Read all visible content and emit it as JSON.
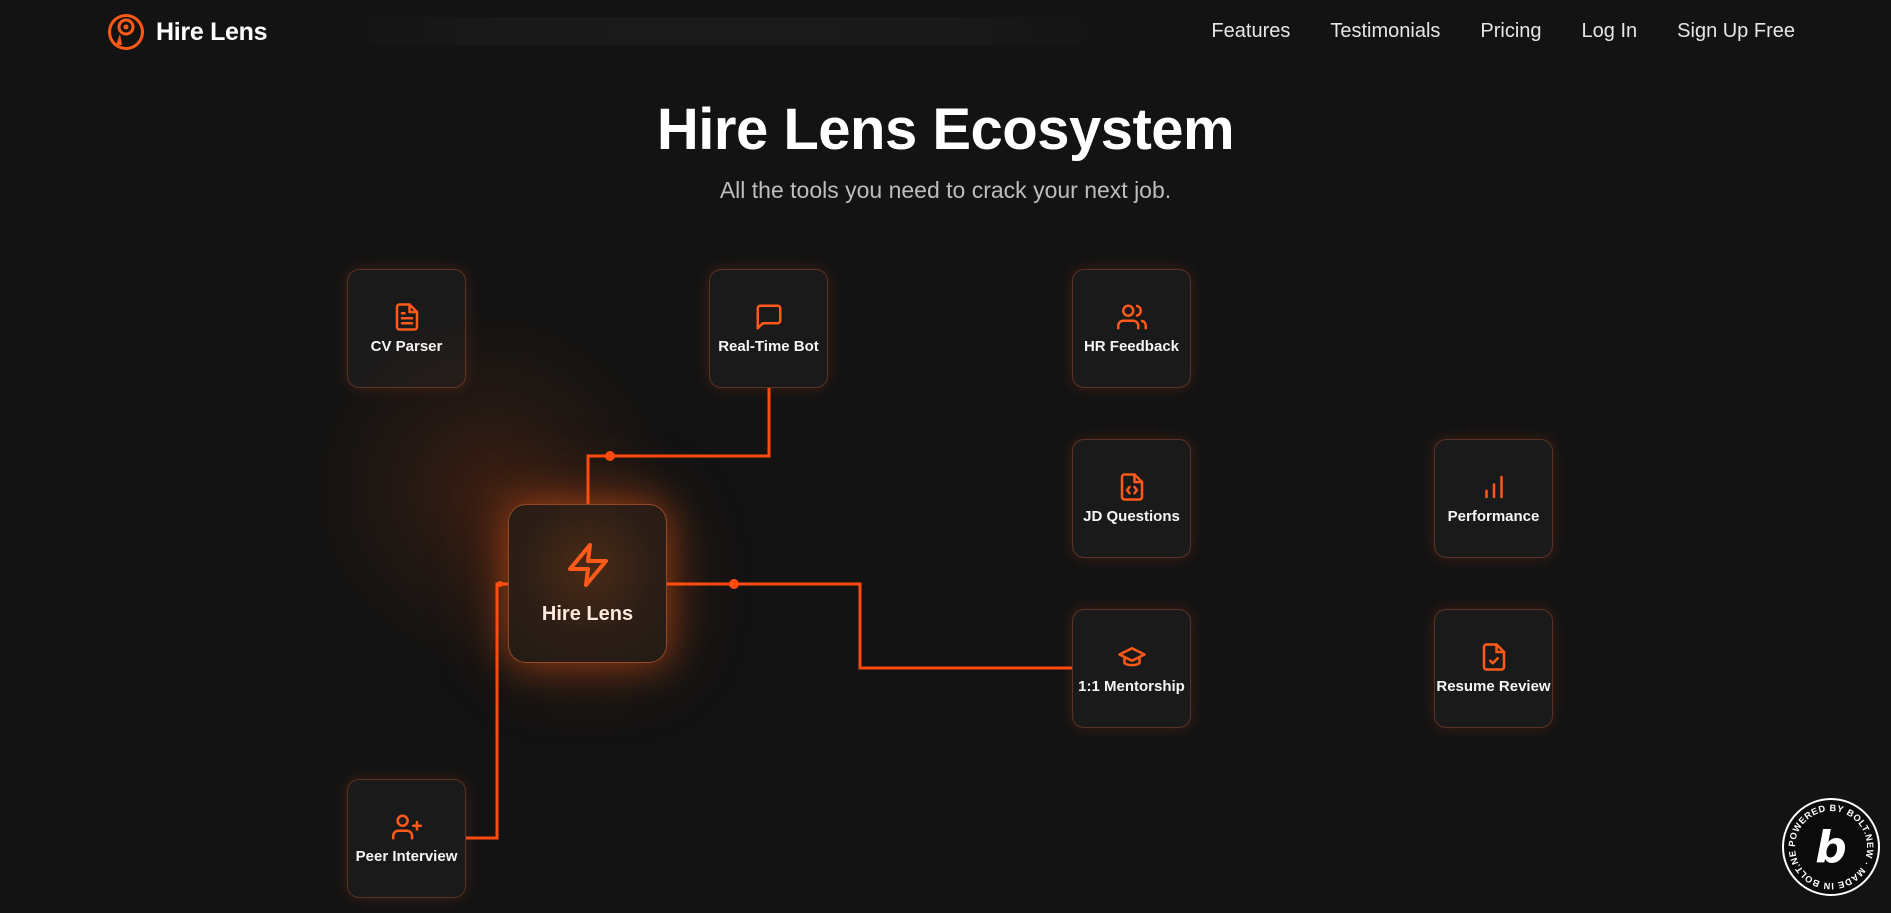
{
  "nav": {
    "brand": "Hire Lens",
    "links": [
      "Features",
      "Testimonials",
      "Pricing",
      "Log In",
      "Sign Up Free"
    ]
  },
  "hero": {
    "title": "Hire Lens Ecosystem",
    "subtitle": "All the tools you need to crack your next job."
  },
  "hub": {
    "label": "Hire Lens",
    "icon": "lightning-bolt-icon"
  },
  "tools": [
    {
      "label": "CV Parser",
      "icon": "file-text-icon"
    },
    {
      "label": "Real-Time Bot",
      "icon": "chat-bubble-icon"
    },
    {
      "label": "HR Feedback",
      "icon": "users-icon"
    },
    {
      "label": "JD Questions",
      "icon": "file-code-icon"
    },
    {
      "label": "Performance",
      "icon": "bar-chart-icon"
    },
    {
      "label": "1:1 Mentorship",
      "icon": "graduation-cap-icon"
    },
    {
      "label": "Resume Review",
      "icon": "file-check-icon"
    },
    {
      "label": "Peer Interview",
      "icon": "user-plus-icon"
    }
  ],
  "badge": {
    "text": "POWERED BY BOLT.NEW · MADE IN BOLT.NEW ·",
    "letter": "b"
  },
  "colors": {
    "accent": "#ff5a1a",
    "background": "#131313",
    "card": "#1a1a1a"
  }
}
